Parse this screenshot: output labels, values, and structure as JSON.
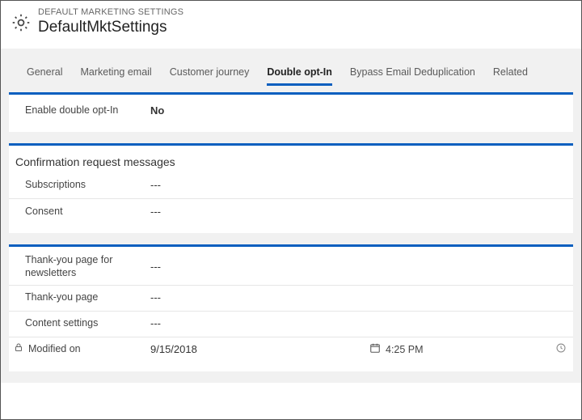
{
  "header": {
    "supertitle": "DEFAULT MARKETING SETTINGS",
    "title": "DefaultMktSettings"
  },
  "tabs": {
    "items": [
      {
        "label": "General"
      },
      {
        "label": "Marketing email"
      },
      {
        "label": "Customer journey"
      },
      {
        "label": "Double opt-In"
      },
      {
        "label": "Bypass Email Deduplication"
      },
      {
        "label": "Related"
      }
    ],
    "active_index": 3
  },
  "sections": {
    "main": {
      "rows": {
        "enable_label": "Enable double opt-In",
        "enable_value": "No"
      }
    },
    "confirm": {
      "title": "Confirmation request messages",
      "rows": {
        "subscriptions_label": "Subscriptions",
        "subscriptions_value": "---",
        "consent_label": "Consent",
        "consent_value": "---"
      }
    },
    "thanks": {
      "rows": {
        "tynews_label": "Thank-you page for newsletters",
        "tynews_value": "---",
        "ty_label": "Thank-you page",
        "ty_value": "---",
        "content_label": "Content settings",
        "content_value": "---",
        "modified_label": "Modified on",
        "modified_date": "9/15/2018",
        "modified_time": "4:25 PM"
      }
    }
  }
}
